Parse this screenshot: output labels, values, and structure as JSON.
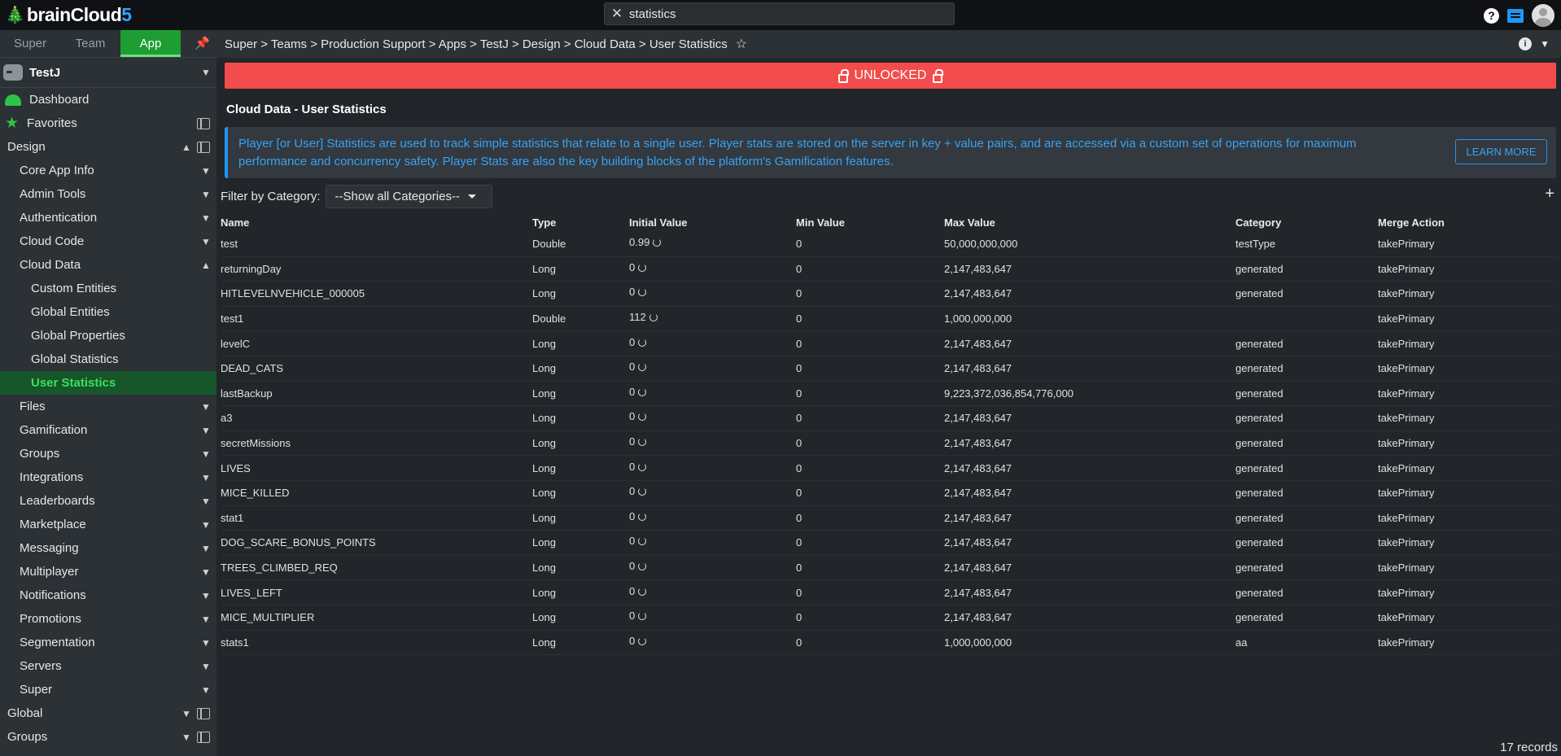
{
  "header": {
    "brand_prefix": "brainCloud",
    "brand_suffix": "5",
    "search_value": "statistics"
  },
  "sidebar": {
    "tabs": [
      "Super",
      "Team",
      "App"
    ],
    "active_tab": "App",
    "app_name": "TestJ",
    "items": [
      {
        "label": "Dashboard",
        "level": 0
      },
      {
        "label": "Favorites",
        "level": 0
      },
      {
        "label": "Design",
        "level": 0
      },
      {
        "label": "Core App Info",
        "level": 1
      },
      {
        "label": "Admin Tools",
        "level": 1
      },
      {
        "label": "Authentication",
        "level": 1
      },
      {
        "label": "Cloud Code",
        "level": 1
      },
      {
        "label": "Cloud Data",
        "level": 1
      },
      {
        "label": "Custom Entities",
        "level": 2
      },
      {
        "label": "Global Entities",
        "level": 2
      },
      {
        "label": "Global Properties",
        "level": 2
      },
      {
        "label": "Global Statistics",
        "level": 2
      },
      {
        "label": "User Statistics",
        "level": 2
      },
      {
        "label": "Files",
        "level": 1
      },
      {
        "label": "Gamification",
        "level": 1
      },
      {
        "label": "Groups",
        "level": 1
      },
      {
        "label": "Integrations",
        "level": 1
      },
      {
        "label": "Leaderboards",
        "level": 1
      },
      {
        "label": "Marketplace",
        "level": 1
      },
      {
        "label": "Messaging",
        "level": 1
      },
      {
        "label": "Multiplayer",
        "level": 1
      },
      {
        "label": "Notifications",
        "level": 1
      },
      {
        "label": "Promotions",
        "level": 1
      },
      {
        "label": "Segmentation",
        "level": 1
      },
      {
        "label": "Servers",
        "level": 1
      },
      {
        "label": "Super",
        "level": 1
      },
      {
        "label": "Global",
        "level": 0
      },
      {
        "label": "Groups",
        "level": 0
      }
    ]
  },
  "breadcrumb": "Super > Teams > Production Support > Apps > TestJ > Design > Cloud Data > User Statistics",
  "banner": "UNLOCKED",
  "page_title": "Cloud Data - User Statistics",
  "info": {
    "text": "Player [or User] Statistics are used to track simple statistics that relate to a single user. Player stats are stored on the server in key + value pairs, and are accessed via a custom set of operations for maximum performance and concurrency safety. Player Stats are also the key building blocks of the platform's Gamification features.",
    "button": "LEARN MORE"
  },
  "filter": {
    "label": "Filter by Category:",
    "value": "--Show all Categories--"
  },
  "table": {
    "columns": [
      "Name",
      "Type",
      "Initial Value",
      "Min Value",
      "Max Value",
      "Category",
      "Merge Action"
    ],
    "rows": [
      [
        "test",
        "Double",
        "0.99",
        "0",
        "50,000,000,000",
        "testType",
        "takePrimary"
      ],
      [
        "returningDay",
        "Long",
        "0",
        "0",
        "2,147,483,647",
        "generated",
        "takePrimary"
      ],
      [
        "HITLEVELNVEHICLE_000005",
        "Long",
        "0",
        "0",
        "2,147,483,647",
        "generated",
        "takePrimary"
      ],
      [
        "test1",
        "Double",
        "112",
        "0",
        "1,000,000,000",
        "",
        "takePrimary"
      ],
      [
        "levelC",
        "Long",
        "0",
        "0",
        "2,147,483,647",
        "generated",
        "takePrimary"
      ],
      [
        "DEAD_CATS",
        "Long",
        "0",
        "0",
        "2,147,483,647",
        "generated",
        "takePrimary"
      ],
      [
        "lastBackup",
        "Long",
        "0",
        "0",
        "9,223,372,036,854,776,000",
        "generated",
        "takePrimary"
      ],
      [
        "a3",
        "Long",
        "0",
        "0",
        "2,147,483,647",
        "generated",
        "takePrimary"
      ],
      [
        "secretMissions",
        "Long",
        "0",
        "0",
        "2,147,483,647",
        "generated",
        "takePrimary"
      ],
      [
        "LIVES",
        "Long",
        "0",
        "0",
        "2,147,483,647",
        "generated",
        "takePrimary"
      ],
      [
        "MICE_KILLED",
        "Long",
        "0",
        "0",
        "2,147,483,647",
        "generated",
        "takePrimary"
      ],
      [
        "stat1",
        "Long",
        "0",
        "0",
        "2,147,483,647",
        "generated",
        "takePrimary"
      ],
      [
        "DOG_SCARE_BONUS_POINTS",
        "Long",
        "0",
        "0",
        "2,147,483,647",
        "generated",
        "takePrimary"
      ],
      [
        "TREES_CLIMBED_REQ",
        "Long",
        "0",
        "0",
        "2,147,483,647",
        "generated",
        "takePrimary"
      ],
      [
        "LIVES_LEFT",
        "Long",
        "0",
        "0",
        "2,147,483,647",
        "generated",
        "takePrimary"
      ],
      [
        "MICE_MULTIPLIER",
        "Long",
        "0",
        "0",
        "2,147,483,647",
        "generated",
        "takePrimary"
      ],
      [
        "stats1",
        "Long",
        "0",
        "0",
        "1,000,000,000",
        "aa",
        "takePrimary"
      ]
    ]
  },
  "records": "17 records",
  "colors": {
    "accent_green": "#1e9e32",
    "banner_red": "#f44c4c",
    "info_blue": "#37a2f4"
  }
}
